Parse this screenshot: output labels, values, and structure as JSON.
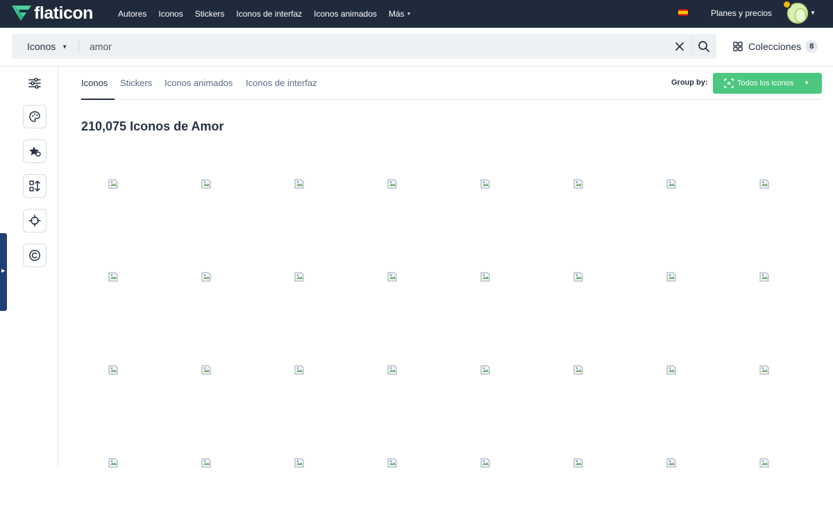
{
  "brand": {
    "name": "flaticon"
  },
  "nav": {
    "items": [
      "Autores",
      "Iconos",
      "Stickers",
      "Iconos de interfaz",
      "Iconos animados"
    ],
    "more_label": "Más",
    "plans_label": "Planes y precios"
  },
  "search": {
    "type_label": "Iconos",
    "query": "amor"
  },
  "collections": {
    "label": "Colecciones",
    "count": "8"
  },
  "tabs": [
    {
      "label": "Iconos",
      "active": true
    },
    {
      "label": "Stickers",
      "active": false
    },
    {
      "label": "Iconos animados",
      "active": false
    },
    {
      "label": "Iconos de interfaz",
      "active": false
    }
  ],
  "group_by": {
    "label": "Group by:",
    "value": "Todos los iconos"
  },
  "results": {
    "title": "210,075 Iconos de Amor",
    "rows": 4,
    "columns": 8
  },
  "sidebar": {
    "icons": [
      "filters-icon",
      "palette-icon",
      "star-shape-icon",
      "shapes-sort-icon",
      "crosshair-icon",
      "copyright-icon"
    ]
  },
  "colors": {
    "topbar": "#1f2a3c",
    "accent_green": "#4bc77f",
    "side_tab": "#1f3f75"
  }
}
